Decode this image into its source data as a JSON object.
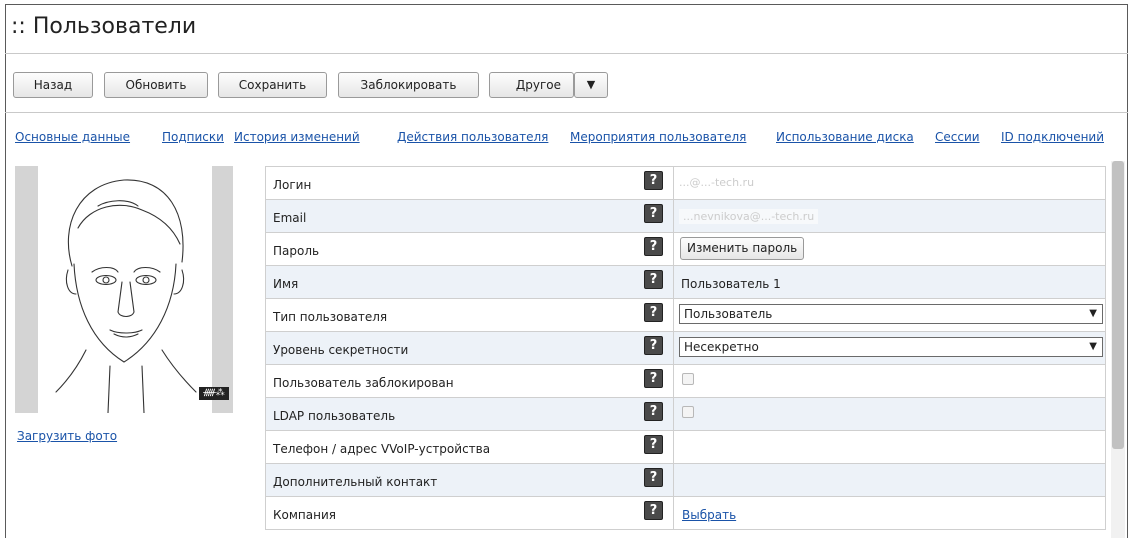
{
  "page": {
    "title": ":: Пользователи"
  },
  "toolbar": {
    "back": "Назад",
    "refresh": "Обновить",
    "save": "Сохранить",
    "block": "Заблокировать",
    "other": "Другое",
    "dropdown_glyph": "▼"
  },
  "tabs": [
    {
      "label": "Основные данные"
    },
    {
      "label": "Подписки"
    },
    {
      "label": "История изменений"
    },
    {
      "label": "Действия пользователя"
    },
    {
      "label": "Мероприятия пользователя"
    },
    {
      "label": "Использование диска"
    },
    {
      "label": "Сессии"
    },
    {
      "label": "ID подключений"
    }
  ],
  "photo": {
    "upload_label": "Загрузить фото",
    "badge_text": "ᚏ⁂"
  },
  "help_glyph": "?",
  "fields": {
    "login": {
      "label": "Логин",
      "value": "...@...-tech.ru"
    },
    "email": {
      "label": "Email",
      "value": "...nevnikova@...-tech.ru"
    },
    "password": {
      "label": "Пароль",
      "button": "Изменить пароль"
    },
    "name": {
      "label": "Имя",
      "value": "Пользователь 1"
    },
    "user_type": {
      "label": "Тип пользователя",
      "value": "Пользователь"
    },
    "secrecy": {
      "label": "Уровень секретности",
      "value": "Несекретно"
    },
    "blocked": {
      "label": "Пользователь заблокирован",
      "checked": false
    },
    "ldap": {
      "label": "LDAP пользователь",
      "checked": false
    },
    "phone": {
      "label": "Телефон / адрес VVoIP-устройства",
      "value": ""
    },
    "extra_contact": {
      "label": "Дополнительный контакт",
      "value": ""
    },
    "company": {
      "label": "Компания",
      "link": "Выбрать"
    }
  },
  "colors": {
    "link": "#1a53a8",
    "alt_row": "#edf2f8",
    "help_bg": "#4a4a4a"
  }
}
